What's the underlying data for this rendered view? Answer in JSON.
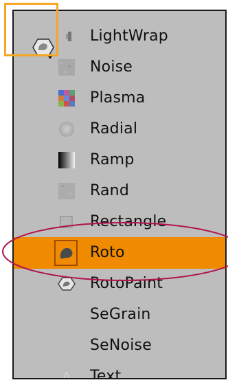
{
  "menu": {
    "items": [
      {
        "label": "LightWrap",
        "icon": "lightwrap-icon"
      },
      {
        "label": "Noise",
        "icon": "noise-icon"
      },
      {
        "label": "Plasma",
        "icon": "plasma-icon"
      },
      {
        "label": "Radial",
        "icon": "radial-icon"
      },
      {
        "label": "Ramp",
        "icon": "ramp-icon"
      },
      {
        "label": "Rand",
        "icon": "rand-icon"
      },
      {
        "label": "Rectangle",
        "icon": "rectangle-icon"
      },
      {
        "label": "Roto",
        "icon": "roto-icon",
        "selected": true
      },
      {
        "label": "RotoPaint",
        "icon": "rotopaint-icon"
      },
      {
        "label": "SeGrain",
        "icon": "none"
      },
      {
        "label": "SeNoise",
        "icon": "none"
      },
      {
        "label": "Text",
        "icon": "text-icon"
      }
    ]
  },
  "colors": {
    "menu_background": "#bdbdbd",
    "selected_background": "#f08a00",
    "highlight_box": "#f5a623",
    "annotation_ellipse": "#b0124f"
  }
}
